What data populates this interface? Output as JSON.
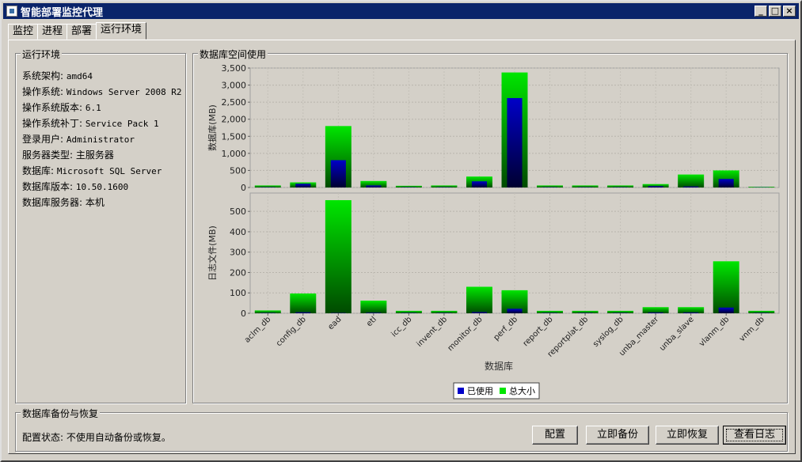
{
  "window": {
    "title": "智能部署监控代理"
  },
  "tabs": [
    {
      "label": "监控"
    },
    {
      "label": "进程"
    },
    {
      "label": "部署"
    },
    {
      "label": "运行环境"
    }
  ],
  "env": {
    "title": "运行环境",
    "rows": [
      {
        "label": "系统架构: ",
        "value": "amd64"
      },
      {
        "label": "操作系统: ",
        "value": "Windows Server 2008 R2"
      },
      {
        "label": "操作系统版本: ",
        "value": "6.1"
      },
      {
        "label": "操作系统补丁: ",
        "value": "Service Pack 1"
      },
      {
        "label": "登录用户: ",
        "value": "Administrator"
      },
      {
        "label": "服务器类型: ",
        "value": "主服务器"
      },
      {
        "label": "数据库: ",
        "value": "Microsoft SQL Server"
      },
      {
        "label": "数据库版本: ",
        "value": "10.50.1600"
      },
      {
        "label": "数据库服务器: ",
        "value": "本机"
      }
    ]
  },
  "chart_section": {
    "title": "数据库空间使用"
  },
  "chart_data": {
    "type": "bar",
    "xlabel": "数据库",
    "categories": [
      "aclm_db",
      "config_db",
      "ead",
      "etl",
      "icc_db",
      "invent_db",
      "monitor_db",
      "perf_db",
      "report_db",
      "reportplat_db",
      "syslog_db",
      "unba_master",
      "unba_slave",
      "vlanm_db",
      "vnm_db"
    ],
    "colors": {
      "used": "#0000c8",
      "total": "#00e600"
    },
    "legend": {
      "used": "已使用",
      "total": "总大小",
      "placement": "bottom"
    },
    "subplots": [
      {
        "ylabel": "数据库(MB)",
        "ylim": [
          0,
          3500
        ],
        "ticks": [
          0,
          500,
          1000,
          1500,
          2000,
          2500,
          3000,
          3500
        ],
        "tick_labels": [
          "0",
          "500",
          "1,000",
          "1,500",
          "2,000",
          "2,500",
          "3,000",
          "3,500"
        ],
        "series": [
          {
            "name": "已使用",
            "values": [
              10,
              110,
              800,
              60,
              10,
              10,
              180,
              2620,
              10,
              10,
              10,
              40,
              30,
              250,
              5
            ]
          },
          {
            "name": "总大小",
            "values": [
              60,
              150,
              1800,
              190,
              50,
              60,
              320,
              3370,
              60,
              60,
              60,
              100,
              380,
              500,
              20
            ]
          }
        ]
      },
      {
        "ylabel": "日志文件(MB)",
        "ylim": [
          0,
          590
        ],
        "ticks": [
          0,
          100,
          200,
          300,
          400,
          500
        ],
        "tick_labels": [
          "0",
          "100",
          "200",
          "300",
          "400",
          "500"
        ],
        "series": [
          {
            "name": "已使用",
            "values": [
              2,
              5,
              2,
              3,
              2,
              2,
              6,
              22,
              2,
              2,
              2,
              4,
              4,
              28,
              2
            ]
          },
          {
            "name": "总大小",
            "values": [
              14,
              97,
              555,
              62,
              12,
              12,
              130,
              113,
              12,
              12,
              12,
              30,
              30,
              255,
              12
            ]
          }
        ]
      }
    ]
  },
  "backup": {
    "title": "数据库备份与恢复",
    "status": "配置状态: 不使用自动备份或恢复。",
    "buttons": {
      "config": "配置",
      "backup": "立即备份",
      "restore": "立即恢复",
      "log": "查看日志"
    }
  }
}
